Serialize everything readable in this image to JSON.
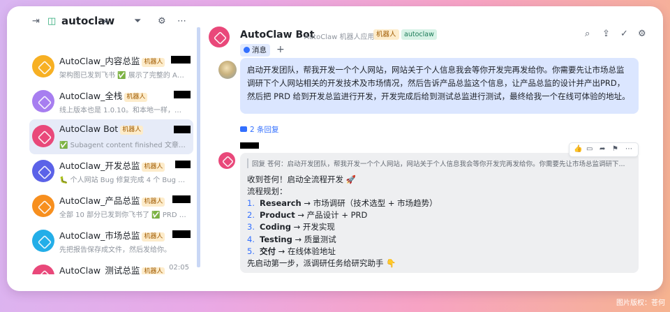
{
  "left_header": {
    "title": "autoclaw",
    "close_glyph": "✕",
    "icons": [
      "sidebar-collapse-icon",
      "tag-icon",
      "close-icon",
      "filter-icon",
      "settings-icon",
      "more-icon"
    ]
  },
  "conversations": [
    {
      "title": "AutoClaw_内容总监",
      "tag": "机器人",
      "preview": "架构图已发到飞书 ✅ 展示了完整的 Age...",
      "avatar_color": "#f7b023",
      "redacted": true,
      "active": false
    },
    {
      "title": "AutoClaw_全栈",
      "tag": "机器人",
      "preview": "线上版本也是 1.0.10。和本地一样，没有...",
      "avatar_color": "#a77ef0",
      "redacted": true,
      "active": false
    },
    {
      "title": "AutoClaw Bot",
      "tag": "机器人",
      "preview": "✅ Subagent content finished 文章已完...",
      "avatar_color": "#e9487a",
      "redacted": true,
      "active": true
    },
    {
      "title": "AutoClaw_开发总监",
      "tag": "机器人",
      "preview": "🐛 个人网站 Bug 修复完成 4 个 Bug 全...",
      "avatar_color": "#5b62e8",
      "redacted": true,
      "active": false
    },
    {
      "title": "AutoClaw_产品总监",
      "tag": "机器人",
      "preview": "全部 10 部分已发到你飞书了 ✅ PRD 太...",
      "avatar_color": "#f78f1e",
      "redacted": true,
      "active": false
    },
    {
      "title": "AutoClaw_市场总监",
      "tag": "机器人",
      "preview": "先把报告保存成文件，然后发给你。",
      "avatar_color": "#23aee8",
      "redacted": true,
      "active": false
    },
    {
      "title": "AutoClaw_测试总监",
      "tag": "机器人",
      "preview": "",
      "avatar_color": "#e9487a",
      "redacted": false,
      "time": "02:05",
      "active": false
    }
  ],
  "chat": {
    "title": "AutoClaw Bot",
    "subtitle": "AutoClaw 机器人应用",
    "badge_bot": "机器人",
    "badge_app": "autoclaw",
    "tab_label": "消息",
    "tab_add": "+",
    "header_icons": [
      "search-icon",
      "share-icon",
      "done-icon",
      "settings-icon"
    ],
    "user_message": "启动开发团队，帮我开发一个个人网站，网站关于个人信息我会等你开发完再发给你。你需要先让市场总监调研下个人网站相关的开发技术及市场情况，然后告诉产品总监这个信息，让产品总监的设计并产出PRD，然后把 PRD 给到开发总监进行开发，开发完成后给到测试总监进行测试，最终给我一个在线可体验的地址。",
    "replies_count": "2 条回复",
    "quote": "回复 苍何：启动开发团队，帮我开发一个个人网站，网站关于个人信息我会等你开发完再发给你。你需要先让市场总监调研下...",
    "bot_intro": "收到苍何！启动全流程开发 🚀",
    "plan_label": "流程规划：",
    "steps": [
      {
        "num": "1.",
        "key": "Research",
        "text": " → 市场调研（技术选型 + 市场趋势）"
      },
      {
        "num": "2.",
        "key": "Product",
        "text": " → 产品设计 + PRD"
      },
      {
        "num": "3.",
        "key": "Coding",
        "text": " → 开发实现"
      },
      {
        "num": "4.",
        "key": "Testing",
        "text": " → 质量测试"
      },
      {
        "num": "5.",
        "key": "交付",
        "text": " → 在线体验地址"
      }
    ],
    "bot_outro": "先启动第一步，派调研任务给研究助手 👇",
    "action_icons": [
      "thumbs-up-icon",
      "reply-icon",
      "forward-icon",
      "flag-icon",
      "more-icon"
    ]
  },
  "credit": "图片版权：苍何",
  "colors": {
    "accent": "#3370ff",
    "user_bubble": "#dbe6ff",
    "bot_bubble": "#eeeff1",
    "active_row": "#e6ebf8"
  }
}
